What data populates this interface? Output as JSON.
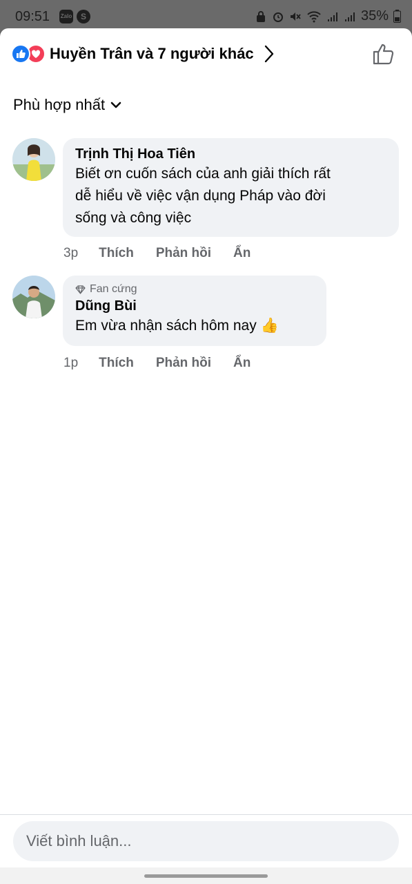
{
  "status_bar": {
    "time": "09:51",
    "apps": [
      "Zalo",
      "S"
    ],
    "battery": "35%",
    "icons": [
      "lock-icon",
      "alarm-icon",
      "mute-icon",
      "wifi-icon",
      "signal-icon",
      "signal-icon",
      "battery-icon"
    ]
  },
  "header": {
    "reactors": "Huyền Trân và 7 người khác",
    "reaction_icons": [
      "like-reaction-icon",
      "love-reaction-icon"
    ]
  },
  "sort": {
    "label": "Phù hợp nhất"
  },
  "comments": [
    {
      "author": "Trịnh Thị Hoa Tiên",
      "lines": [
        "Biết ơn cuốn sách của anh giải thích rất",
        "dễ hiểu về việc vận dụng Pháp vào đời",
        "sống và công việc"
      ],
      "time": "3p",
      "like": "Thích",
      "reply": "Phản hồi",
      "hide": "Ẩn"
    },
    {
      "badge": "Fan cứng",
      "author": "Dũng Bùi",
      "text": "Em vừa nhận sách hôm nay 👍",
      "time": "1p",
      "like": "Thích",
      "reply": "Phản hồi",
      "hide": "Ẩn"
    }
  ],
  "composer": {
    "placeholder": "Viết bình luận..."
  },
  "colors": {
    "accent": "#1877f2",
    "love": "#f33e58",
    "bubble": "#f0f2f5",
    "secondary_text": "#65676b"
  }
}
